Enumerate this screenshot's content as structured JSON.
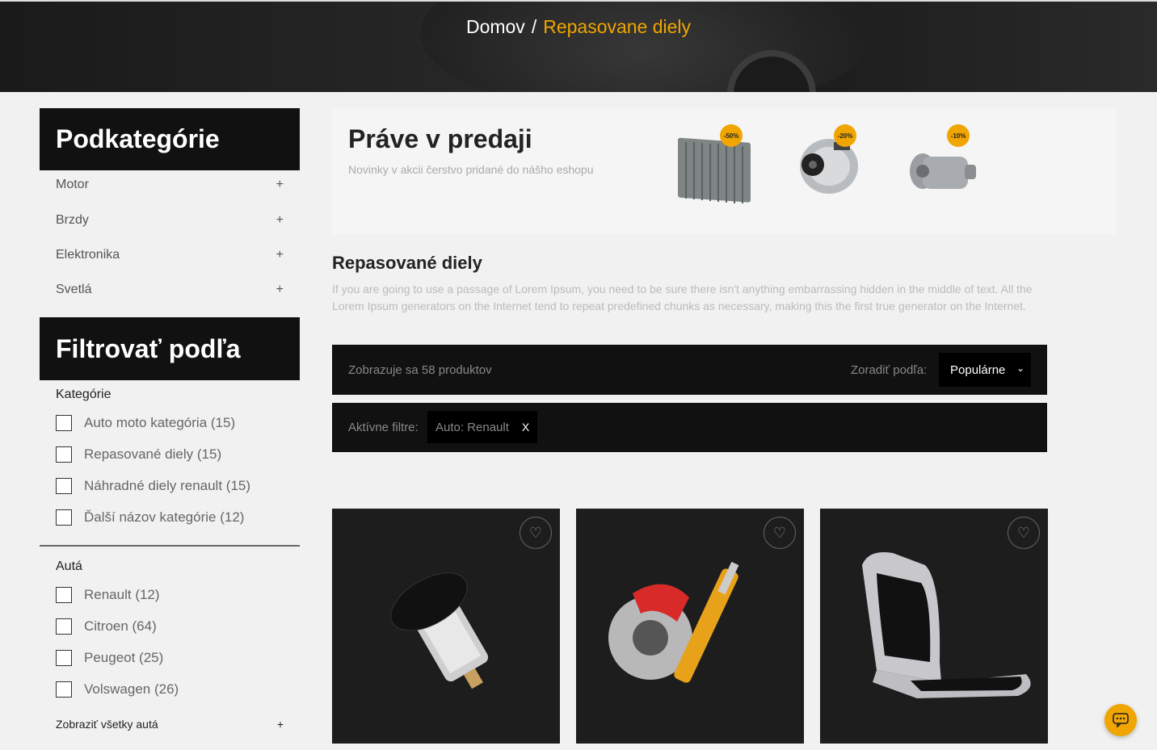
{
  "breadcrumb": {
    "home": "Domov",
    "separator": "/",
    "current": "Repasovane diely"
  },
  "sidebar": {
    "subcategories_title": "Podkategórie",
    "subcategories": [
      {
        "label": "Motor"
      },
      {
        "label": "Brzdy"
      },
      {
        "label": "Elektronika"
      },
      {
        "label": "Svetlá"
      }
    ],
    "expand_symbol": "+",
    "filter_title": "Filtrovať podľa",
    "category_group": {
      "title": "Kategórie",
      "items": [
        "Auto moto kategória (15)",
        "Repasované diely (15)",
        "Náhradné diely renault (15)",
        "Ďalší názov kategórie (12)"
      ]
    },
    "cars_group": {
      "title": "Autá",
      "items": [
        "Renault (12)",
        "Citroen (64)",
        "Peugeot (25)",
        "Volswagen (26)"
      ]
    },
    "show_all": "Zobraziť všetky autá"
  },
  "promo": {
    "title": "Práve v predaji",
    "subtitle": "Novinky v akcii čerstvo pridané do nášho eshopu",
    "items": [
      {
        "name": "radiator",
        "badge": "-50%"
      },
      {
        "name": "alternator",
        "badge": "-20%"
      },
      {
        "name": "transmission",
        "badge": "-10%"
      }
    ]
  },
  "section": {
    "title": "Repasované diely",
    "description": "If you are going to use a passage of Lorem Ipsum, you need to be sure there isn't anything embarrassing hidden in the middle of text. All the Lorem Ipsum generators on the Internet tend to repeat predefined chunks as necessary, making this the first true generator on the Internet."
  },
  "toolbar": {
    "count_text": "Zobrazuje sa 58 produktov",
    "sort_label": "Zoradiť podľa:",
    "sort_value": "Populárne"
  },
  "active_filters": {
    "label": "Aktívne filtre:",
    "chip": "Auto: Renault",
    "remove": "X"
  },
  "products": [
    {
      "name": "power-outlet"
    },
    {
      "name": "brake-and-shock"
    },
    {
      "name": "seat-cushion"
    }
  ],
  "colors": {
    "accent": "#f0a500",
    "dark": "#111111",
    "background": "#f1f1f1"
  }
}
